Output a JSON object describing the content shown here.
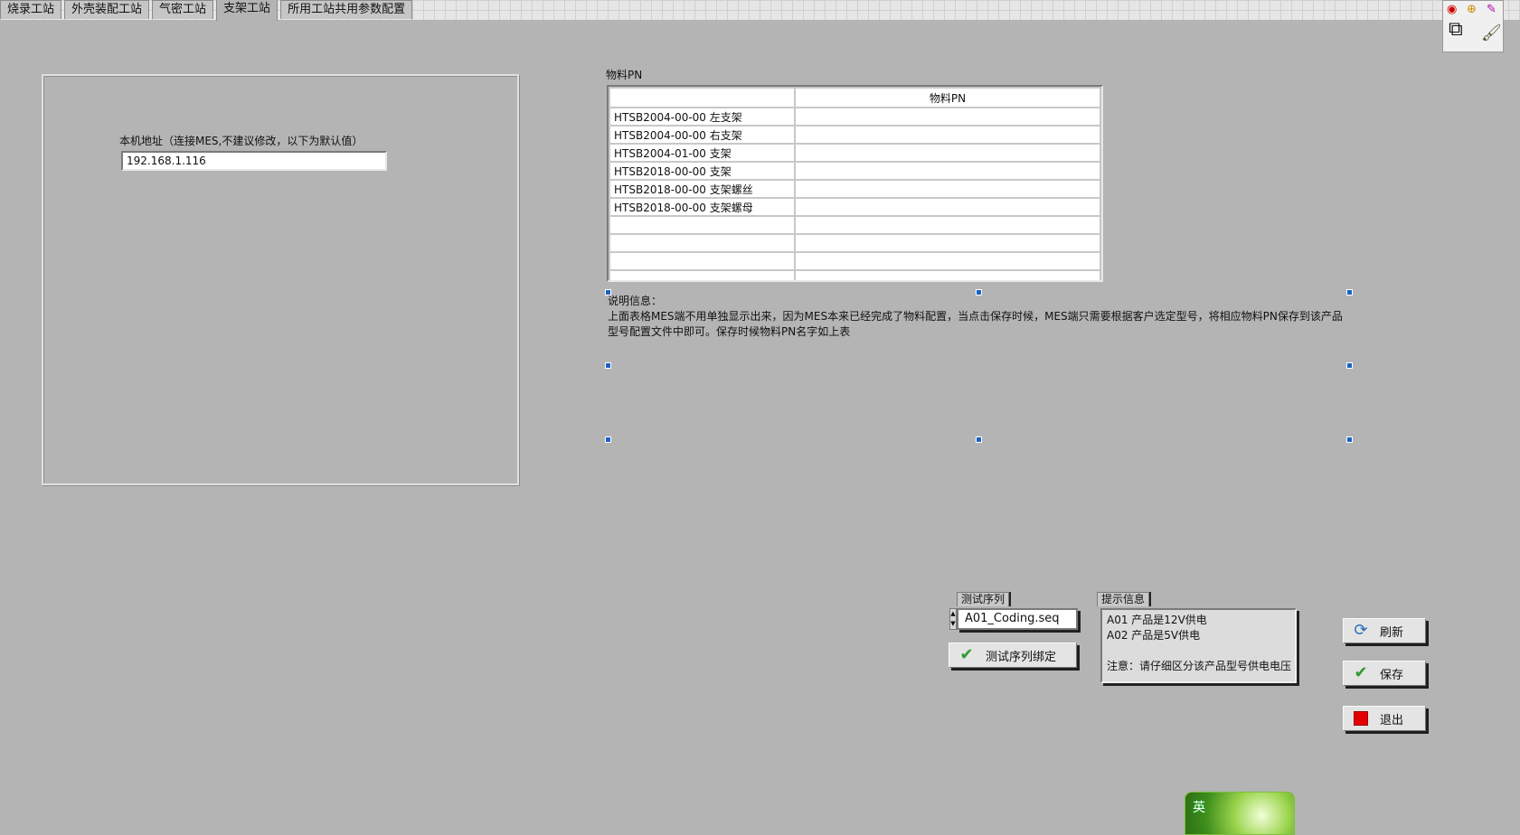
{
  "tabs": [
    {
      "label": "烧录工站",
      "active": false
    },
    {
      "label": "外壳装配工站",
      "active": false
    },
    {
      "label": "气密工站",
      "active": false
    },
    {
      "label": "支架工站",
      "active": true
    },
    {
      "label": "所用工站共用参数配置",
      "active": false
    }
  ],
  "toolbox": {
    "icons": [
      "operate-tool-icon",
      "probe-tool-icon",
      "color-picker-icon",
      "color-swatch-icon",
      "brush-tool-icon"
    ]
  },
  "local": {
    "label": "本机地址（连接MES,不建议修改，以下为默认值）",
    "ip_value": "192.168.1.116"
  },
  "pn_table": {
    "caption": "物料PN",
    "header": [
      "",
      "物料PN"
    ],
    "rows": [
      [
        "HTSB2004-00-00 左支架",
        ""
      ],
      [
        "HTSB2004-00-00 右支架",
        ""
      ],
      [
        "HTSB2004-01-00 支架",
        ""
      ],
      [
        "HTSB2018-00-00 支架",
        ""
      ],
      [
        "HTSB2018-00-00 支架螺丝",
        ""
      ],
      [
        "HTSB2018-00-00 支架螺母",
        ""
      ],
      [
        "",
        ""
      ],
      [
        "",
        ""
      ],
      [
        "",
        ""
      ],
      [
        "",
        ""
      ]
    ]
  },
  "description": {
    "title": "说明信息：",
    "body": "上面表格MES端不用单独显示出来，因为MES本来已经完成了物料配置，当点击保存时候，MES端只需要根据客户选定型号，将相应物料PN保存到该产品型号配置文件中即可。保存时候物料PN名字如上表"
  },
  "test_sequence": {
    "label": "测试序列",
    "value": "A01_Coding.seq",
    "bind_button": "测试序列绑定"
  },
  "hint": {
    "label": "提示信息",
    "text": "A01 产品是12V供电\nA02 产品是5V供电\n\n注意：请仔细区分该产品型号供电电压"
  },
  "buttons": {
    "refresh": "刷新",
    "save": "保存",
    "exit": "退出"
  },
  "ime": {
    "char": "英"
  }
}
